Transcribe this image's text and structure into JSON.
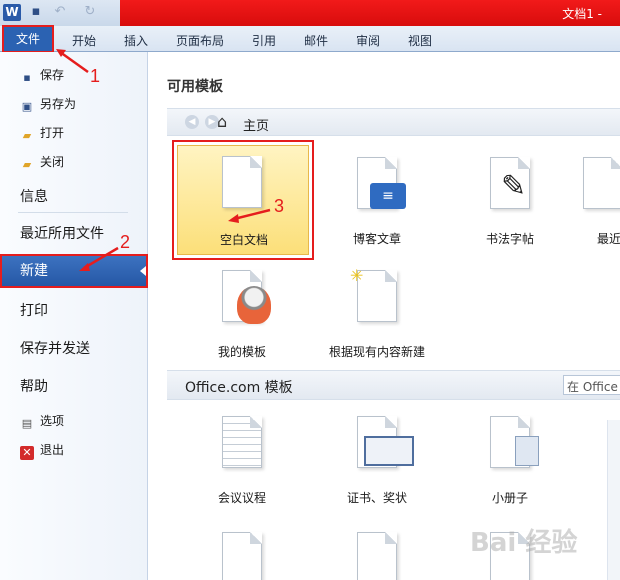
{
  "titlebar": {
    "title": "文档1 -",
    "app_icon": "W"
  },
  "ribbon": {
    "file_tab": "文件",
    "tabs": [
      "开始",
      "插入",
      "页面布局",
      "引用",
      "邮件",
      "审阅",
      "视图"
    ]
  },
  "left_menu": {
    "save": "保存",
    "save_as": "另存为",
    "open": "打开",
    "close": "关闭",
    "info": "信息",
    "recent": "最近所用文件",
    "new": "新建",
    "print": "打印",
    "save_send": "保存并发送",
    "help": "帮助",
    "options": "选项",
    "exit": "退出"
  },
  "main": {
    "available_templates": "可用模板",
    "home": "主页",
    "templates": [
      "空白文档",
      "博客文章",
      "书法字帖",
      "最近",
      "我的模板",
      "根据现有内容新建"
    ],
    "office_section": "Office.com 模板",
    "search_placeholder": "在 Office",
    "office_templates": [
      "会议议程",
      "证书、奖状",
      "小册子"
    ]
  },
  "annotations": [
    "1",
    "2",
    "3"
  ],
  "watermark": "Bai 经验"
}
